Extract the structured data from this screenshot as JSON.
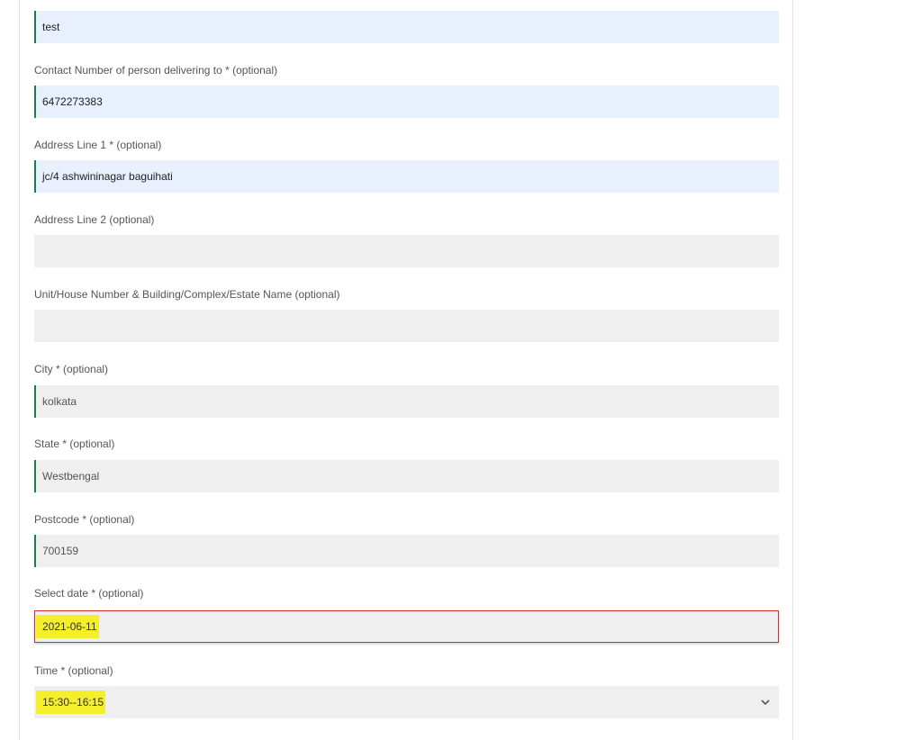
{
  "form": {
    "top_value": "test",
    "contact": {
      "label": "Contact Number of person delivering to * (optional)",
      "value": "6472273383"
    },
    "address1": {
      "label": "Address Line 1 * (optional)",
      "value": "jc/4 ashwininagar baguihati"
    },
    "address2": {
      "label": "Address Line 2 (optional)",
      "value": ""
    },
    "unit": {
      "label": "Unit/House Number & Building/Complex/Estate Name (optional)",
      "value": ""
    },
    "city": {
      "label": "City * (optional)",
      "value": "kolkata"
    },
    "state": {
      "label": "State * (optional)",
      "value": "Westbengal"
    },
    "postcode": {
      "label": "Postcode * (optional)",
      "value": "700159"
    },
    "date": {
      "label": "Select date * (optional)",
      "value": "2021-06-11"
    },
    "time": {
      "label": "Time * (optional)",
      "value": "15:30--16:15"
    }
  },
  "colors": {
    "autofill": "#e8f0fe",
    "field": "#efefef",
    "valid": "#1e7e4a",
    "invalid": "#d32f2f",
    "highlight": "#f4ef2a"
  },
  "icons": {
    "time_select": "chevron-down-icon"
  }
}
